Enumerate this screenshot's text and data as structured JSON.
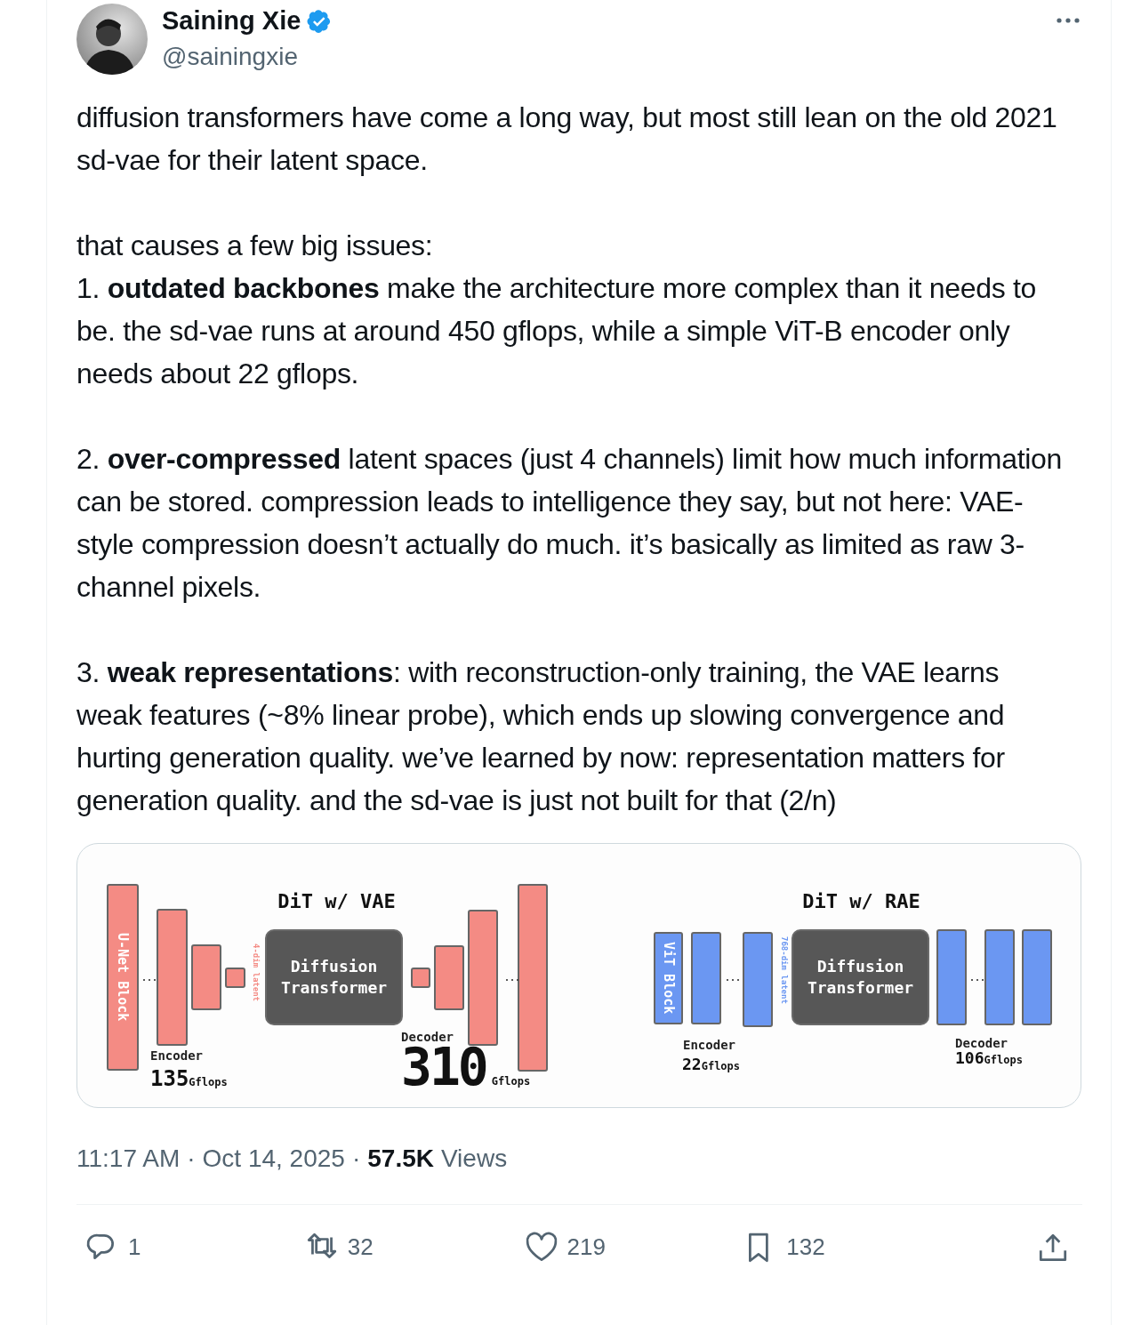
{
  "author": {
    "name": "Saining Xie",
    "handle": "@sainingxie",
    "verified": true
  },
  "paragraphs": [
    {
      "lines": [
        "diffusion transformers have come a long way, but most still lean on the old 2021 sd-vae for their latent space."
      ]
    },
    {
      "lines": [
        "that causes a few big issues:",
        "1. **outdated backbones** make the architecture more complex than it needs to be. the sd-vae runs at around 450 gflops, while a simple ViT-B encoder only needs about 22 gflops."
      ]
    },
    {
      "lines": [
        "2. **over-compressed** latent spaces (just 4 channels) limit how much information can be stored. compression leads to intelligence they say, but not here: VAE-style compression doesn’t actually do much. it’s basically as limited as raw 3-channel pixels."
      ]
    },
    {
      "lines": [
        "3. **weak representations**: with reconstruction-only training, the VAE learns weak features (~8% linear probe), which ends up slowing convergence and hurting generation quality. we’ve learned by now: representation matters for generation quality. and the sd-vae is just not built for that (2/n)"
      ]
    }
  ],
  "figure": {
    "panels": [
      {
        "kind": "vae",
        "color": "#f48b84",
        "title": "DiT w/ VAE",
        "block_label": "U-Net Block",
        "ellipses": [
          "...",
          "..."
        ],
        "latent_label": "4-dim latent",
        "transformer_label": "Diffusion Transformer",
        "encoder": {
          "label": "Encoder",
          "value": "135",
          "unit": "Gflops"
        },
        "decoder": {
          "label": "Decoder",
          "value": "310",
          "unit": "Gflops"
        }
      },
      {
        "kind": "rae",
        "color": "#6b97f2",
        "title": "DiT w/ RAE",
        "block_label": "ViT Block",
        "ellipses": [
          "...",
          "..."
        ],
        "latent_label": "768-dim latent",
        "transformer_label": "Diffusion Transformer",
        "encoder": {
          "label": "Encoder",
          "value": "22",
          "unit": "Gflops"
        },
        "decoder": {
          "label": "Decoder",
          "value": "106",
          "unit": "Gflops"
        }
      }
    ]
  },
  "timestamp": "11:17 AM",
  "separators": [
    "·",
    "·"
  ],
  "date": "Oct 14, 2025",
  "views": {
    "count": "57.5K",
    "label": "Views"
  },
  "actions": [
    {
      "kind": "reply",
      "count": "1"
    },
    {
      "kind": "repost",
      "count": "32"
    },
    {
      "kind": "like",
      "count": "219"
    },
    {
      "kind": "bookmark",
      "count": "132"
    },
    {
      "kind": "share"
    }
  ]
}
